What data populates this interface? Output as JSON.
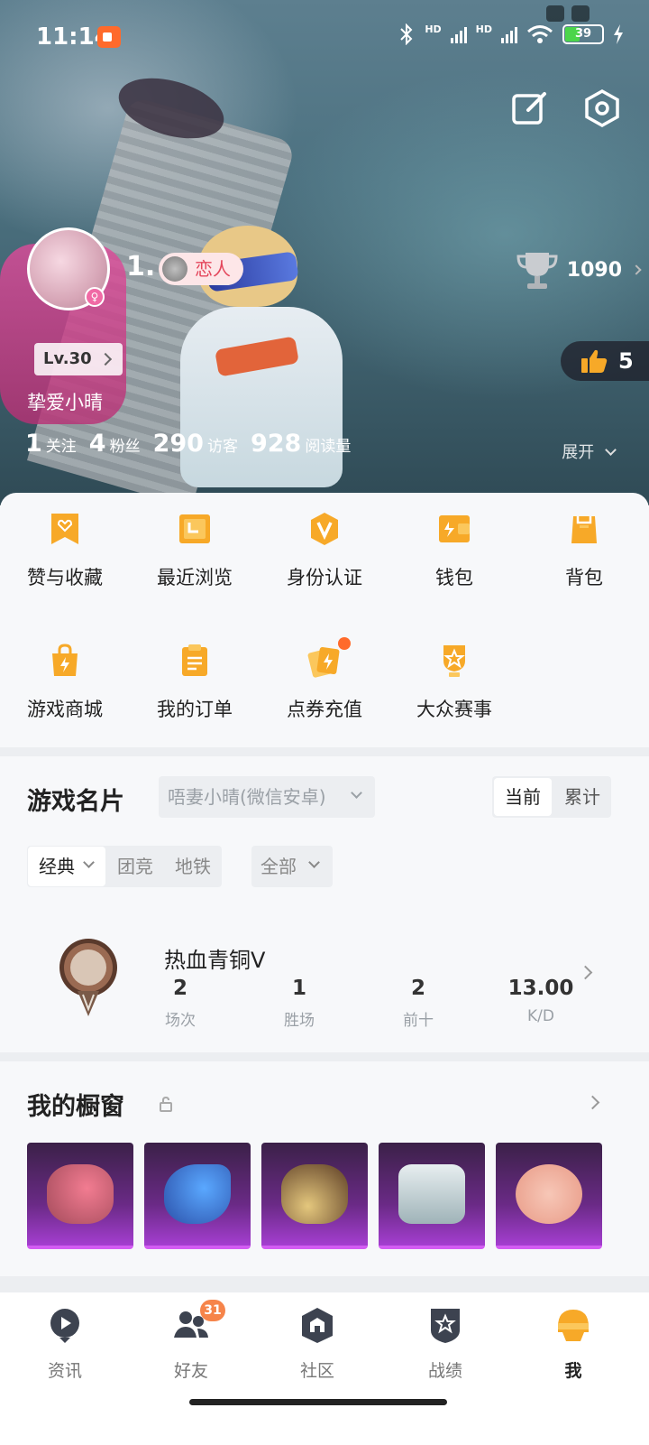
{
  "status_bar": {
    "time": "11:14",
    "signal_label_1": "HD",
    "signal_label_2": "HD",
    "battery": "39"
  },
  "profile": {
    "user_number": "1.",
    "lover_tag": "恋人",
    "level": "Lv.30",
    "nickname": "挚爱小晴",
    "trophy_score": "1090",
    "likes": "5",
    "expand_label": "展开",
    "stats": [
      {
        "value": "1",
        "label": "关注"
      },
      {
        "value": "4",
        "label": "粉丝"
      },
      {
        "value": "290",
        "label": "访客"
      },
      {
        "value": "928",
        "label": "阅读量"
      }
    ]
  },
  "grid": [
    {
      "label": "赞与收藏",
      "icon": "heart-bookmark-icon"
    },
    {
      "label": "最近浏览",
      "icon": "recent-folder-icon"
    },
    {
      "label": "身份认证",
      "icon": "verified-v-icon"
    },
    {
      "label": "钱包",
      "icon": "wallet-icon"
    },
    {
      "label": "背包",
      "icon": "backpack-icon"
    },
    {
      "label": "游戏商城",
      "icon": "shop-bag-icon"
    },
    {
      "label": "我的订单",
      "icon": "clipboard-icon"
    },
    {
      "label": "点券充值",
      "icon": "coupon-cards-icon"
    },
    {
      "label": "大众赛事",
      "icon": "medal-star-icon"
    }
  ],
  "game_card": {
    "title": "游戏名片",
    "account": "唔妻小晴(微信安卓)",
    "toggle": [
      "当前",
      "累计"
    ],
    "modes": [
      "经典",
      "团竞",
      "地铁"
    ],
    "filter": "全部",
    "rank_name": "热血青铜V",
    "rank_stats": [
      {
        "value": "2",
        "label": "场次"
      },
      {
        "value": "1",
        "label": "胜场"
      },
      {
        "value": "2",
        "label": "前十"
      },
      {
        "value": "13.00",
        "label": "K/D"
      }
    ]
  },
  "showcase": {
    "title": "我的橱窗",
    "items": [
      "pink-bow-item",
      "blue-headphones-item",
      "top-hat-item",
      "white-outfit-item",
      "pig-mask-item"
    ]
  },
  "bottom_nav": [
    {
      "label": "资讯",
      "icon": "play-news-icon"
    },
    {
      "label": "好友",
      "icon": "friends-icon",
      "badge": "31"
    },
    {
      "label": "社区",
      "icon": "community-house-icon"
    },
    {
      "label": "战绩",
      "icon": "record-shield-icon"
    },
    {
      "label": "我",
      "icon": "me-helmet-icon",
      "active": true
    }
  ],
  "colors": {
    "accent_orange": "#f7a928",
    "badge_orange": "#ff6a2b",
    "showcase_purple": "#6a2a86"
  }
}
